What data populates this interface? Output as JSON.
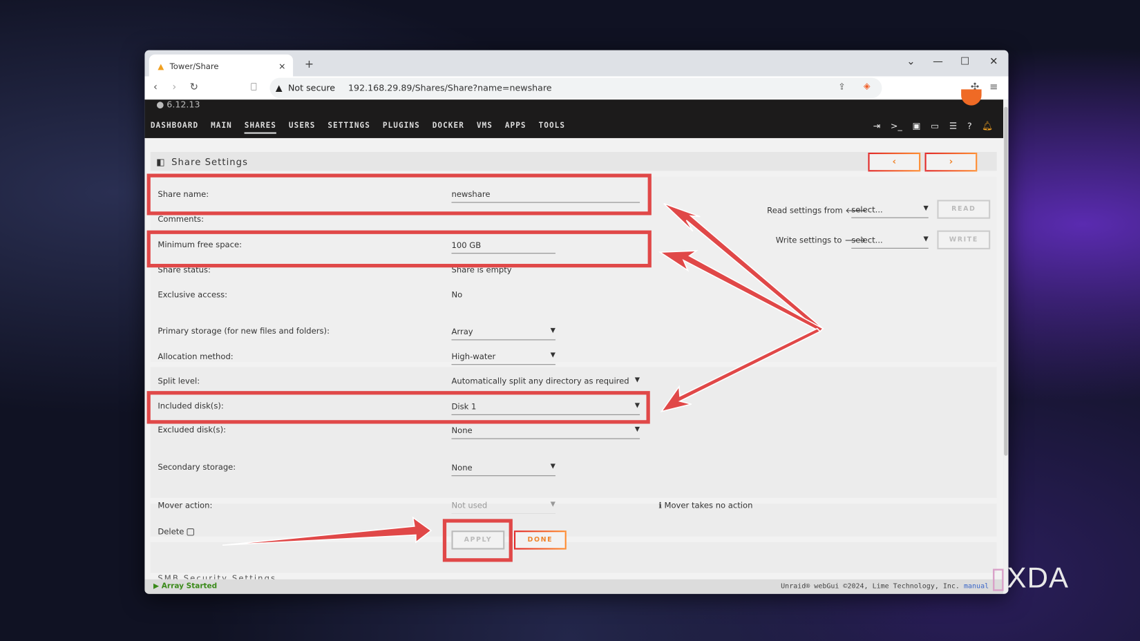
{
  "browser": {
    "tab_title": "Tower/Share",
    "tab_close": "×",
    "new_tab": "+",
    "security": "Not secure",
    "url": "192.168.29.89/Shares/Share?name=newshare"
  },
  "header": {
    "version": "6.12.13",
    "nav": [
      "DASHBOARD",
      "MAIN",
      "SHARES",
      "USERS",
      "SETTINGS",
      "PLUGINS",
      "DOCKER",
      "VMS",
      "APPS",
      "TOOLS"
    ],
    "active": "SHARES"
  },
  "panel": {
    "title": "Share Settings",
    "prev": "‹",
    "next": "›"
  },
  "copy": {
    "read_label": "Read settings from",
    "read_select": "select...",
    "read_btn": "READ",
    "write_label": "Write settings to",
    "write_select": "select...",
    "write_btn": "WRITE"
  },
  "form": {
    "share_name": {
      "label": "Share name:",
      "value": "newshare"
    },
    "comments": {
      "label": "Comments:"
    },
    "min_free": {
      "label": "Minimum free space:",
      "value": "100 GB"
    },
    "status": {
      "label": "Share status:",
      "value": "Share is empty"
    },
    "exclusive": {
      "label": "Exclusive access:",
      "value": "No"
    },
    "primary": {
      "label": "Primary storage (for new files and folders):",
      "value": "Array"
    },
    "allocation": {
      "label": "Allocation method:",
      "value": "High-water"
    },
    "split": {
      "label": "Split level:",
      "value": "Automatically split any directory as required"
    },
    "included": {
      "label": "Included disk(s):",
      "value": "Disk 1"
    },
    "excluded": {
      "label": "Excluded disk(s):",
      "value": "None"
    },
    "secondary": {
      "label": "Secondary storage:",
      "value": "None"
    },
    "mover": {
      "label": "Mover action:",
      "value": "Not used",
      "info": "Mover takes no action"
    },
    "delete": {
      "label": "Delete"
    },
    "apply": "APPLY",
    "done": "DONE"
  },
  "next_section": "SMB Security Settings",
  "statusbar": {
    "array": "Array Started",
    "copyright": "Unraid® webGui ©2024, Lime Technology, Inc.",
    "manual": "manual"
  },
  "watermark": "XDA",
  "colors": {
    "accent": "#f0852d",
    "annotation": "#e04848"
  }
}
